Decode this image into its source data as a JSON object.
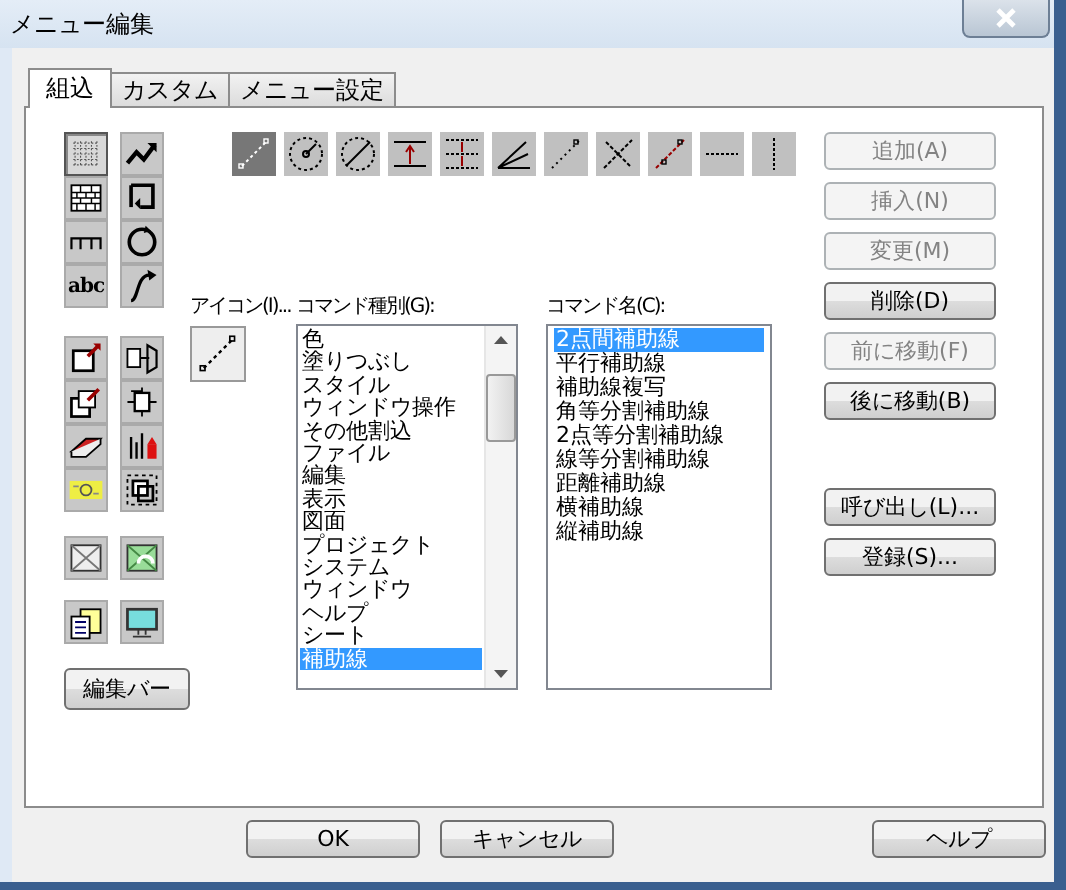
{
  "window": {
    "title": "メニュー編集"
  },
  "tabs": [
    {
      "label": "組込",
      "selected": true
    },
    {
      "label": "カスタム",
      "selected": false
    },
    {
      "label": "メニュー設定",
      "selected": false
    }
  ],
  "palette": [
    {
      "selected": true
    },
    {
      "selected": false
    },
    {
      "selected": false
    },
    {
      "selected": false
    },
    {
      "selected": false
    },
    {
      "selected": false
    },
    {
      "selected": false,
      "label": "abc"
    },
    {
      "selected": false
    },
    {
      "selected": false
    },
    {
      "selected": false
    },
    {
      "selected": false
    },
    {
      "selected": false
    },
    {
      "selected": false
    },
    {
      "selected": false
    },
    {
      "selected": false
    },
    {
      "selected": false
    },
    {
      "selected": false
    },
    {
      "selected": false
    },
    {
      "selected": false
    },
    {
      "selected": false
    }
  ],
  "edit_bar_button": "編集バー",
  "tool_icons": [
    {
      "selected": true
    },
    {
      "selected": false
    },
    {
      "selected": false
    },
    {
      "selected": false
    },
    {
      "selected": false
    },
    {
      "selected": false
    },
    {
      "selected": false
    },
    {
      "selected": false
    },
    {
      "selected": false
    },
    {
      "selected": false
    },
    {
      "selected": false
    }
  ],
  "icon_label": "アイコン(I)...",
  "type_label": "コマンド種別(G):",
  "name_label": "コマンド名(C):",
  "command_types": [
    {
      "label": "色",
      "selected": false
    },
    {
      "label": "塗りつぶし",
      "selected": false
    },
    {
      "label": "スタイル",
      "selected": false
    },
    {
      "label": "ウィンドウ操作",
      "selected": false
    },
    {
      "label": "その他割込",
      "selected": false
    },
    {
      "label": "ファイル",
      "selected": false
    },
    {
      "label": "編集",
      "selected": false
    },
    {
      "label": "表示",
      "selected": false
    },
    {
      "label": "図面",
      "selected": false
    },
    {
      "label": "プロジェクト",
      "selected": false
    },
    {
      "label": "システム",
      "selected": false
    },
    {
      "label": "ウィンドウ",
      "selected": false
    },
    {
      "label": "ヘルプ",
      "selected": false
    },
    {
      "label": "シート",
      "selected": false
    },
    {
      "label": "補助線",
      "selected": true
    }
  ],
  "command_names": [
    {
      "label": "2点間補助線",
      "selected": true
    },
    {
      "label": "平行補助線",
      "selected": false
    },
    {
      "label": "補助線複写",
      "selected": false
    },
    {
      "label": "角等分割補助線",
      "selected": false
    },
    {
      "label": "2点等分割補助線",
      "selected": false
    },
    {
      "label": "線等分割補助線",
      "selected": false
    },
    {
      "label": "距離補助線",
      "selected": false
    },
    {
      "label": "横補助線",
      "selected": false
    },
    {
      "label": "縦補助線",
      "selected": false
    }
  ],
  "side_buttons": [
    {
      "label": "追加(A)",
      "disabled": true
    },
    {
      "label": "挿入(N)",
      "disabled": true
    },
    {
      "label": "変更(M)",
      "disabled": true
    },
    {
      "label": "削除(D)",
      "disabled": false
    },
    {
      "label": "前に移動(F)",
      "disabled": true
    },
    {
      "label": "後に移動(B)",
      "disabled": false
    },
    {
      "label": "呼び出し(L)...",
      "disabled": false,
      "gap": true
    },
    {
      "label": "登録(S)...",
      "disabled": false
    }
  ],
  "footer_buttons": [
    {
      "label": "OK"
    },
    {
      "label": "キャンセル"
    },
    {
      "label": "ヘルプ",
      "spaced": true
    }
  ]
}
